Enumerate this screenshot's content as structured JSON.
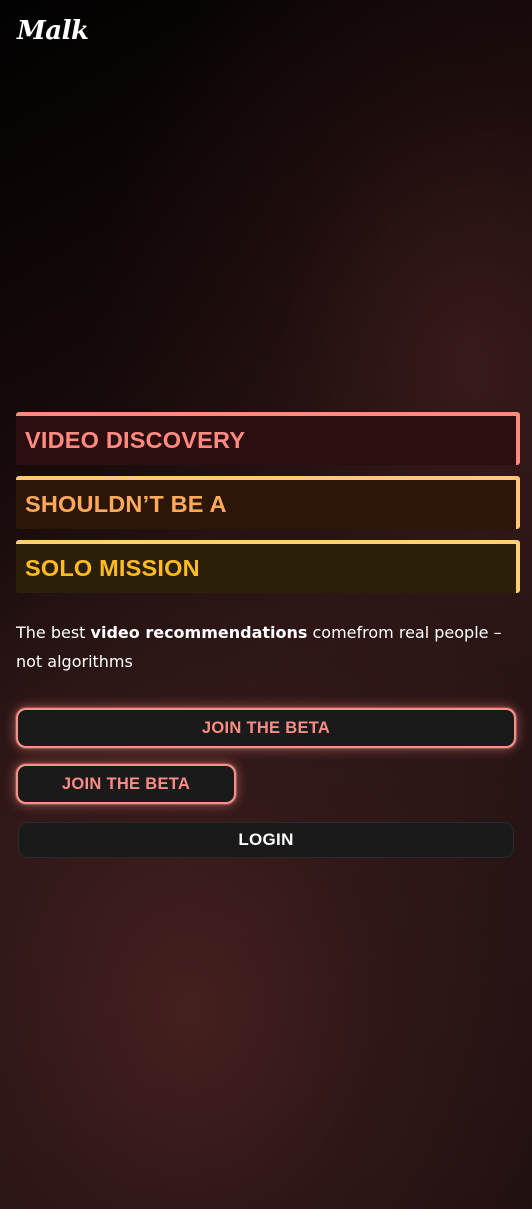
{
  "brand": {
    "logo_text": "Malk"
  },
  "hero": {
    "lines": [
      "VIDEO DISCOVERY",
      "SHOULDN’T BE A",
      "SOLO MISSION"
    ],
    "tagline": {
      "prefix": "The best ",
      "emphasis": "video recommendations",
      "suffix": " comefrom real people – not algorithms"
    }
  },
  "actions": {
    "join_beta_primary": "JOIN THE BETA",
    "join_beta_secondary": "JOIN THE BETA",
    "login": "LOGIN"
  },
  "colors": {
    "accent_pink": "#ff8a80",
    "accent_orange": "#ffa95c",
    "accent_yellow": "#ffbc22",
    "button_bg": "#1a1a1b"
  }
}
